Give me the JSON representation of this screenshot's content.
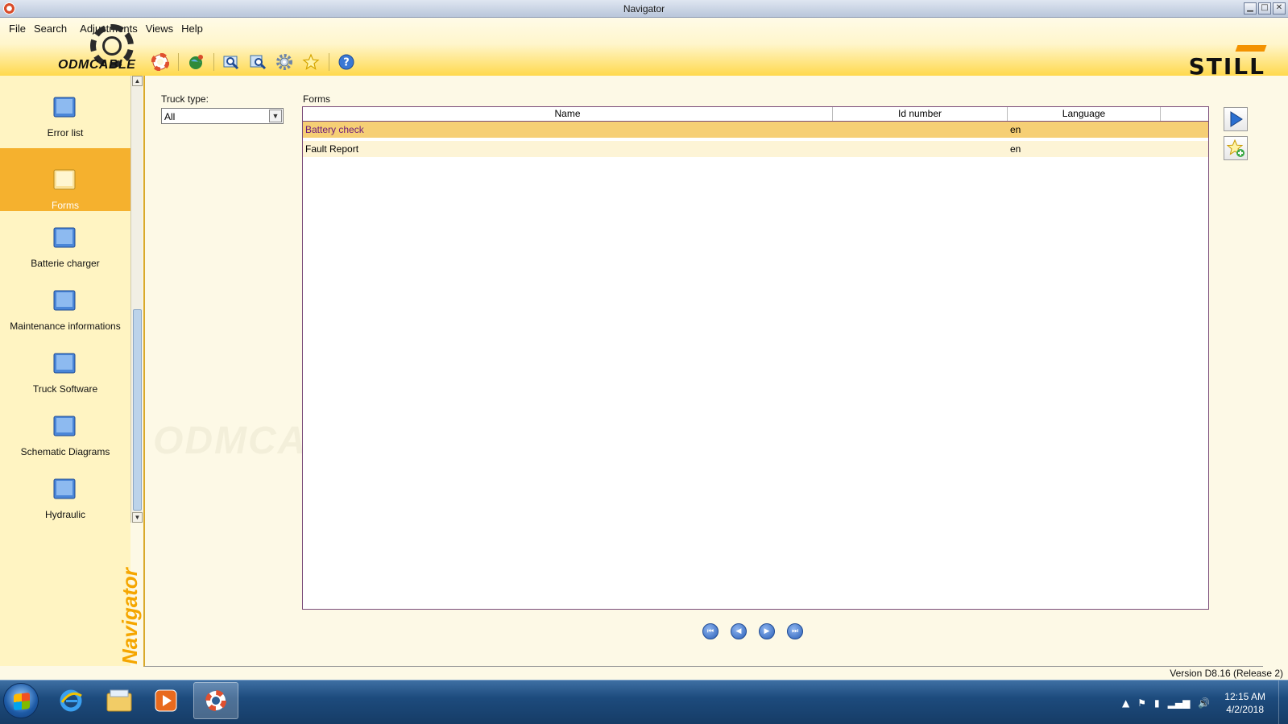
{
  "window": {
    "title": "Navigator"
  },
  "menu": [
    "File",
    "Search",
    "Adjustments",
    "Views",
    "Help"
  ],
  "brand": {
    "watermark_logo": "ODMCABLE",
    "company_logo": "STILL"
  },
  "toolbar_icons": [
    "lifebuoy-icon",
    "globe-icon",
    "magnifier-icon",
    "search-list-icon",
    "settings-icon",
    "favorites-star-icon",
    "help-icon"
  ],
  "sidebar": {
    "items": [
      {
        "label": "Error list",
        "active": false
      },
      {
        "label": "Forms",
        "active": true
      },
      {
        "label": "Batterie charger",
        "active": false
      },
      {
        "label": "Maintenance informations",
        "active": false
      },
      {
        "label": "Truck Software",
        "active": false
      },
      {
        "label": "Schematic Diagrams",
        "active": false
      },
      {
        "label": "Hydraulic",
        "active": false
      }
    ],
    "vertical_title": "Navigator"
  },
  "filter": {
    "label": "Truck type:",
    "value": "All"
  },
  "forms": {
    "label": "Forms",
    "columns": [
      "Name",
      "Id number",
      "Language",
      ""
    ],
    "rows": [
      {
        "name": "Battery check",
        "id": "",
        "language": "en",
        "selected": true
      },
      {
        "name": "Fault Report",
        "id": "",
        "language": "en",
        "selected": false
      }
    ]
  },
  "version": "Version D8.16 (Release 2)",
  "taskbar": {
    "time": "12:15 AM",
    "date": "4/2/2018"
  }
}
